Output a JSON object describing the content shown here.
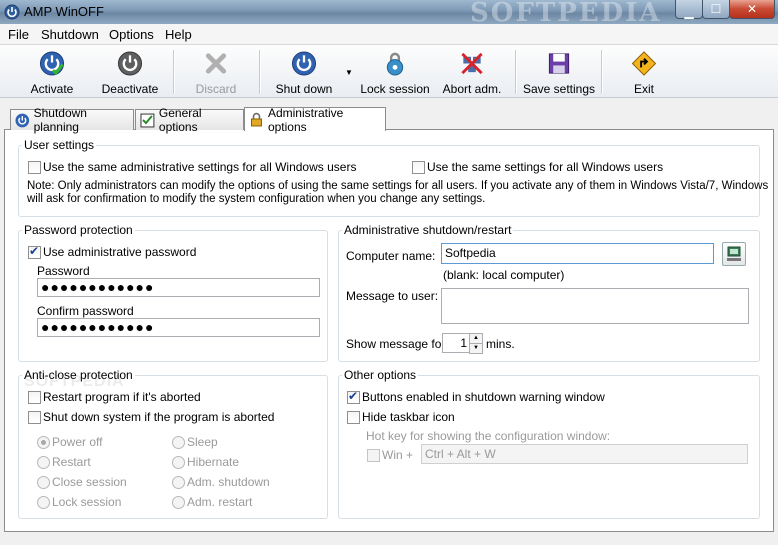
{
  "window": {
    "title": "AMP WinOFF",
    "watermark": "SOFTPEDIA"
  },
  "menu": [
    "File",
    "Shutdown",
    "Options",
    "Help"
  ],
  "toolbar": {
    "activate": "Activate",
    "deactivate": "Deactivate",
    "discard": "Discard",
    "shutdown": "Shut down",
    "lock": "Lock session",
    "abort": "Abort adm.",
    "save": "Save settings",
    "exit": "Exit"
  },
  "tabs": [
    "Shutdown planning",
    "General options",
    "Administrative options"
  ],
  "user_settings": {
    "title": "User settings",
    "same_admin": "Use the same administrative settings for all Windows users",
    "same_settings": "Use the same settings for all Windows users",
    "note1": "Note: Only administrators can modify the options of using the same settings for all users. If you activate any of them in Windows Vista/7, Windows",
    "note2": "will ask for confirmation to modify the system configuration when you change any settings."
  },
  "password": {
    "title": "Password protection",
    "use_admin": "Use administrative password",
    "password_label": "Password",
    "password_value": "●●●●●●●●●●●●",
    "confirm_label": "Confirm password",
    "confirm_value": "●●●●●●●●●●●●"
  },
  "admin_shutdown": {
    "title": "Administrative shutdown/restart",
    "computer_label": "Computer name:",
    "computer_value": "Softpedia",
    "blank_hint": "(blank: local computer)",
    "message_label": "Message to user:",
    "show_label": "Show message for:",
    "show_value": "1",
    "mins": "mins."
  },
  "anti_close": {
    "title": "Anti-close protection",
    "restart_aborted": "Restart program if it's aborted",
    "shutdown_aborted": "Shut down system if the program is aborted",
    "options": [
      "Power off",
      "Sleep",
      "Restart",
      "Hibernate",
      "Close session",
      "Adm. shutdown",
      "Lock session",
      "Adm. restart"
    ]
  },
  "other": {
    "title": "Other options",
    "buttons_enabled": "Buttons enabled in shutdown warning window",
    "hide_taskbar": "Hide taskbar icon",
    "hotkey_label": "Hot key for showing the configuration window:",
    "win_label": "Win +",
    "hotkey_value": "Ctrl + Alt + W"
  }
}
